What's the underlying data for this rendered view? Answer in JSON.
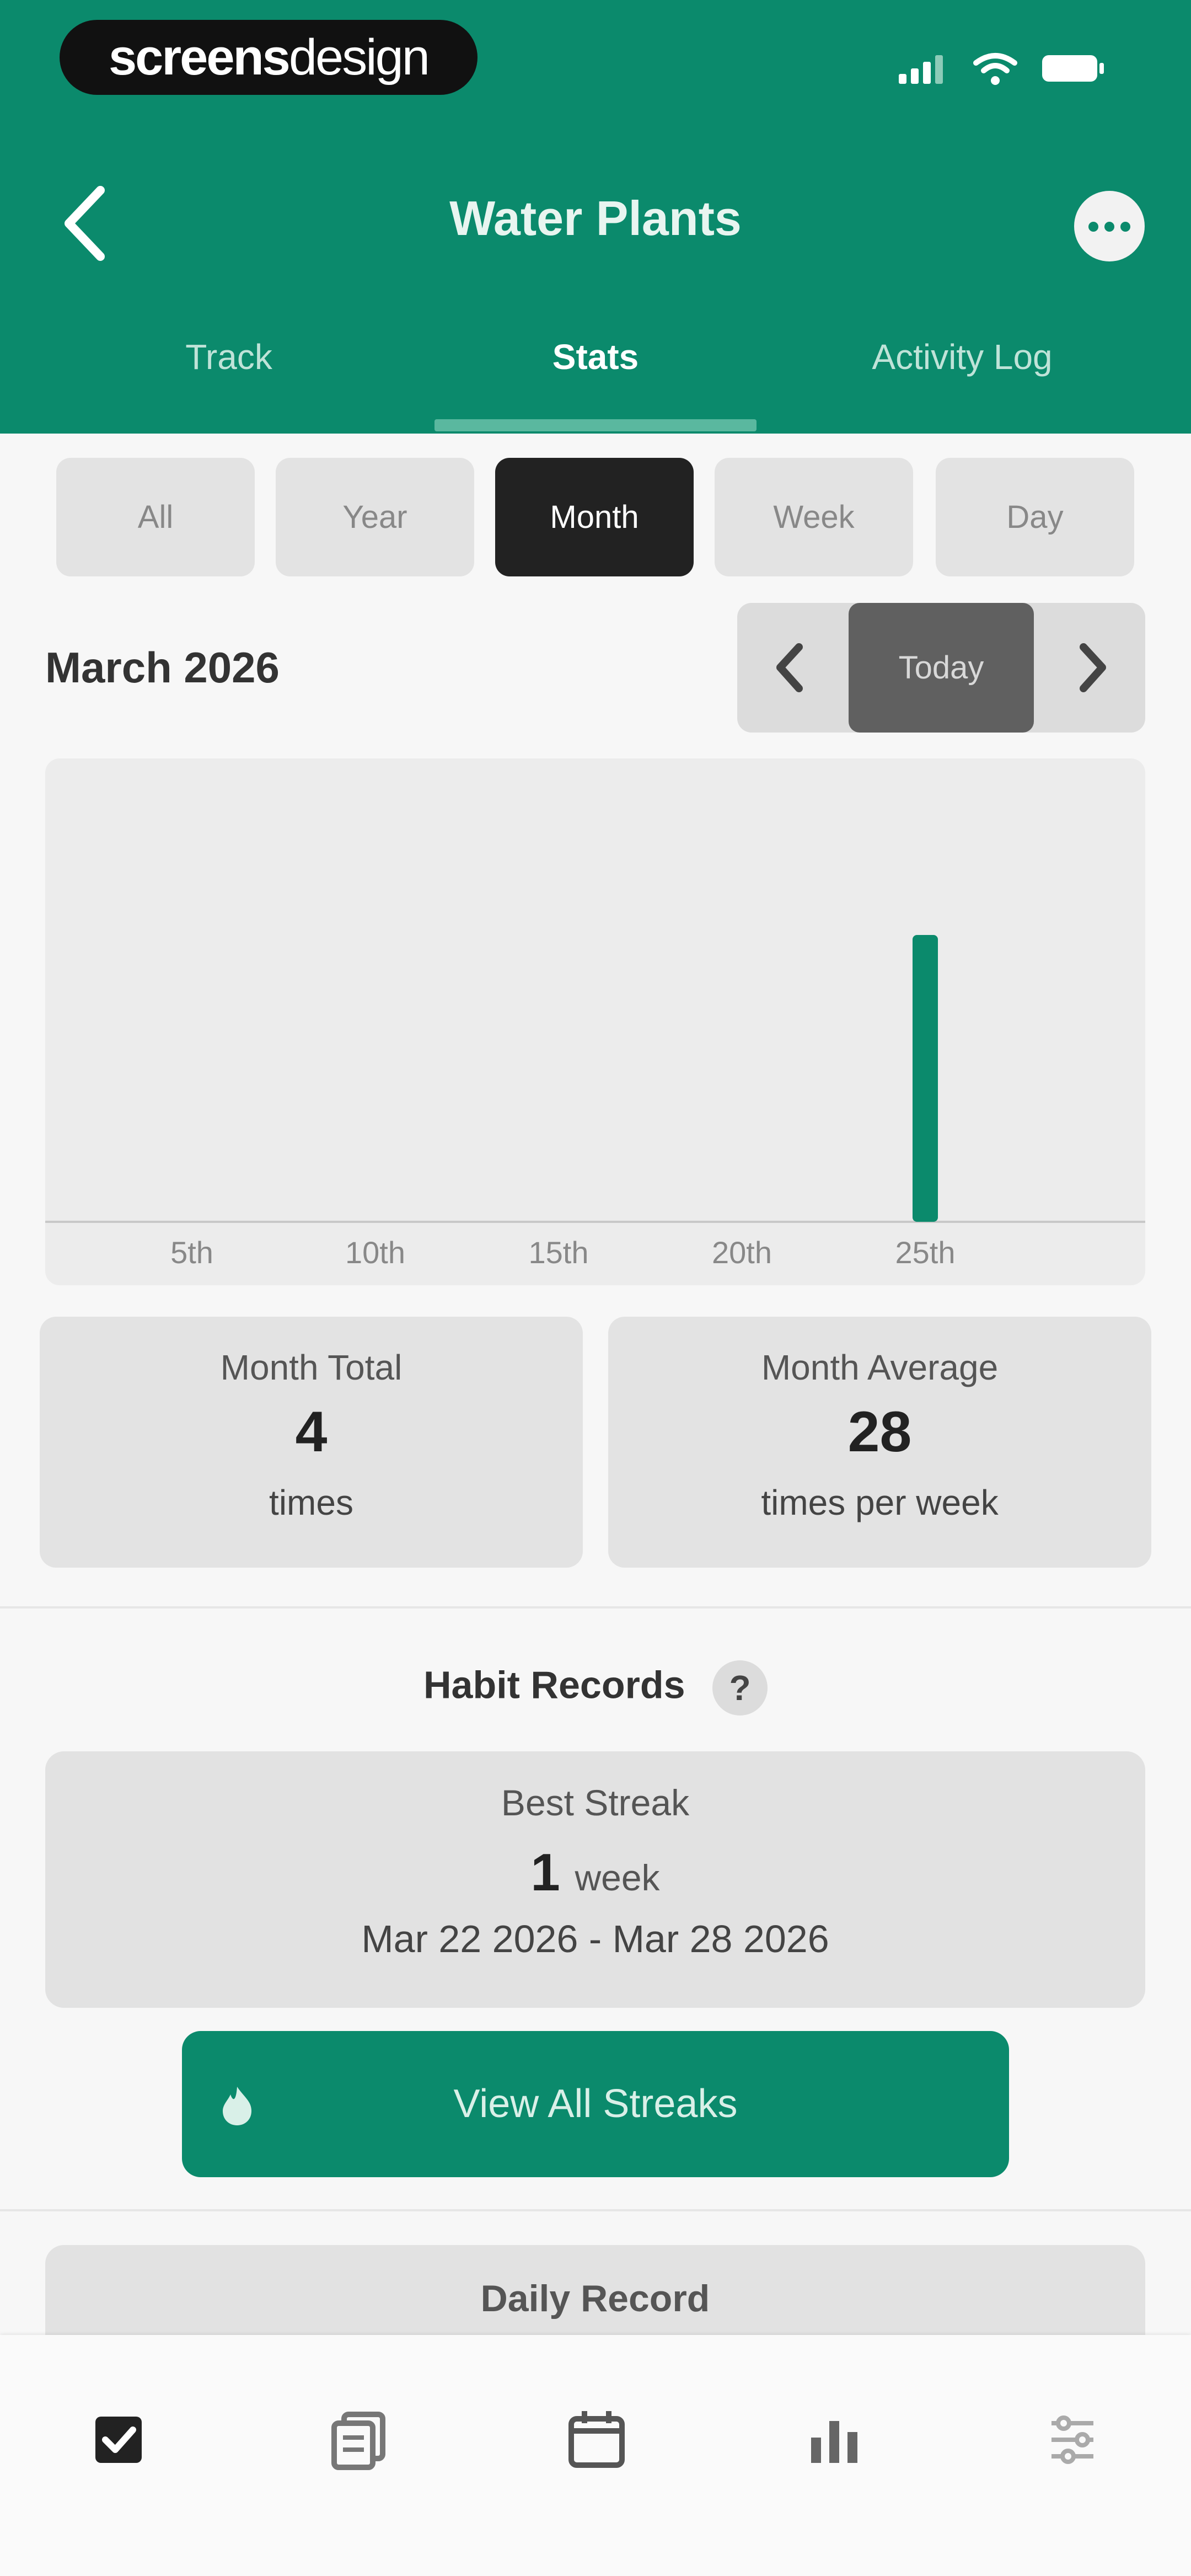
{
  "status_bar": {
    "logo_bold": "screens",
    "logo_light": "design"
  },
  "header": {
    "title": "Water Plants"
  },
  "tabs": [
    {
      "label": "Track",
      "active": false
    },
    {
      "label": "Stats",
      "active": true
    },
    {
      "label": "Activity Log",
      "active": false
    }
  ],
  "range_selector": [
    {
      "label": "All",
      "active": false
    },
    {
      "label": "Year",
      "active": false
    },
    {
      "label": "Month",
      "active": true
    },
    {
      "label": "Week",
      "active": false
    },
    {
      "label": "Day",
      "active": false
    }
  ],
  "period": {
    "label": "March 2026",
    "today_label": "Today"
  },
  "chart_data": {
    "type": "bar",
    "x": [
      25
    ],
    "values": [
      4
    ],
    "xlim": [
      1,
      31
    ],
    "ylim": [
      0,
      4.5
    ],
    "tick_labels": [
      "5th",
      "10th",
      "15th",
      "20th",
      "25th"
    ],
    "tick_values": [
      5,
      10,
      15,
      20,
      25
    ],
    "color": "#0b8a6c",
    "grid": false
  },
  "stats": {
    "total": {
      "label": "Month Total",
      "value": "4",
      "unit": "times"
    },
    "average": {
      "label": "Month Average",
      "value": "28",
      "unit": "times per week"
    }
  },
  "records": {
    "title": "Habit Records",
    "help": "?",
    "best_streak": {
      "label": "Best Streak",
      "value": "1",
      "unit": "week",
      "range": "Mar 22 2026 - Mar 28 2026"
    },
    "view_all_label": "View All Streaks",
    "daily_record_label": "Daily Record"
  },
  "bottom_nav": [
    {
      "icon": "checkbox-icon",
      "active": true
    },
    {
      "icon": "notes-icon",
      "active": false
    },
    {
      "icon": "calendar-icon",
      "active": false
    },
    {
      "icon": "stats-icon",
      "active": false
    },
    {
      "icon": "settings-icon",
      "active": false
    }
  ],
  "colors": {
    "brand": "#0b8a6c",
    "active_segment": "#222222"
  }
}
